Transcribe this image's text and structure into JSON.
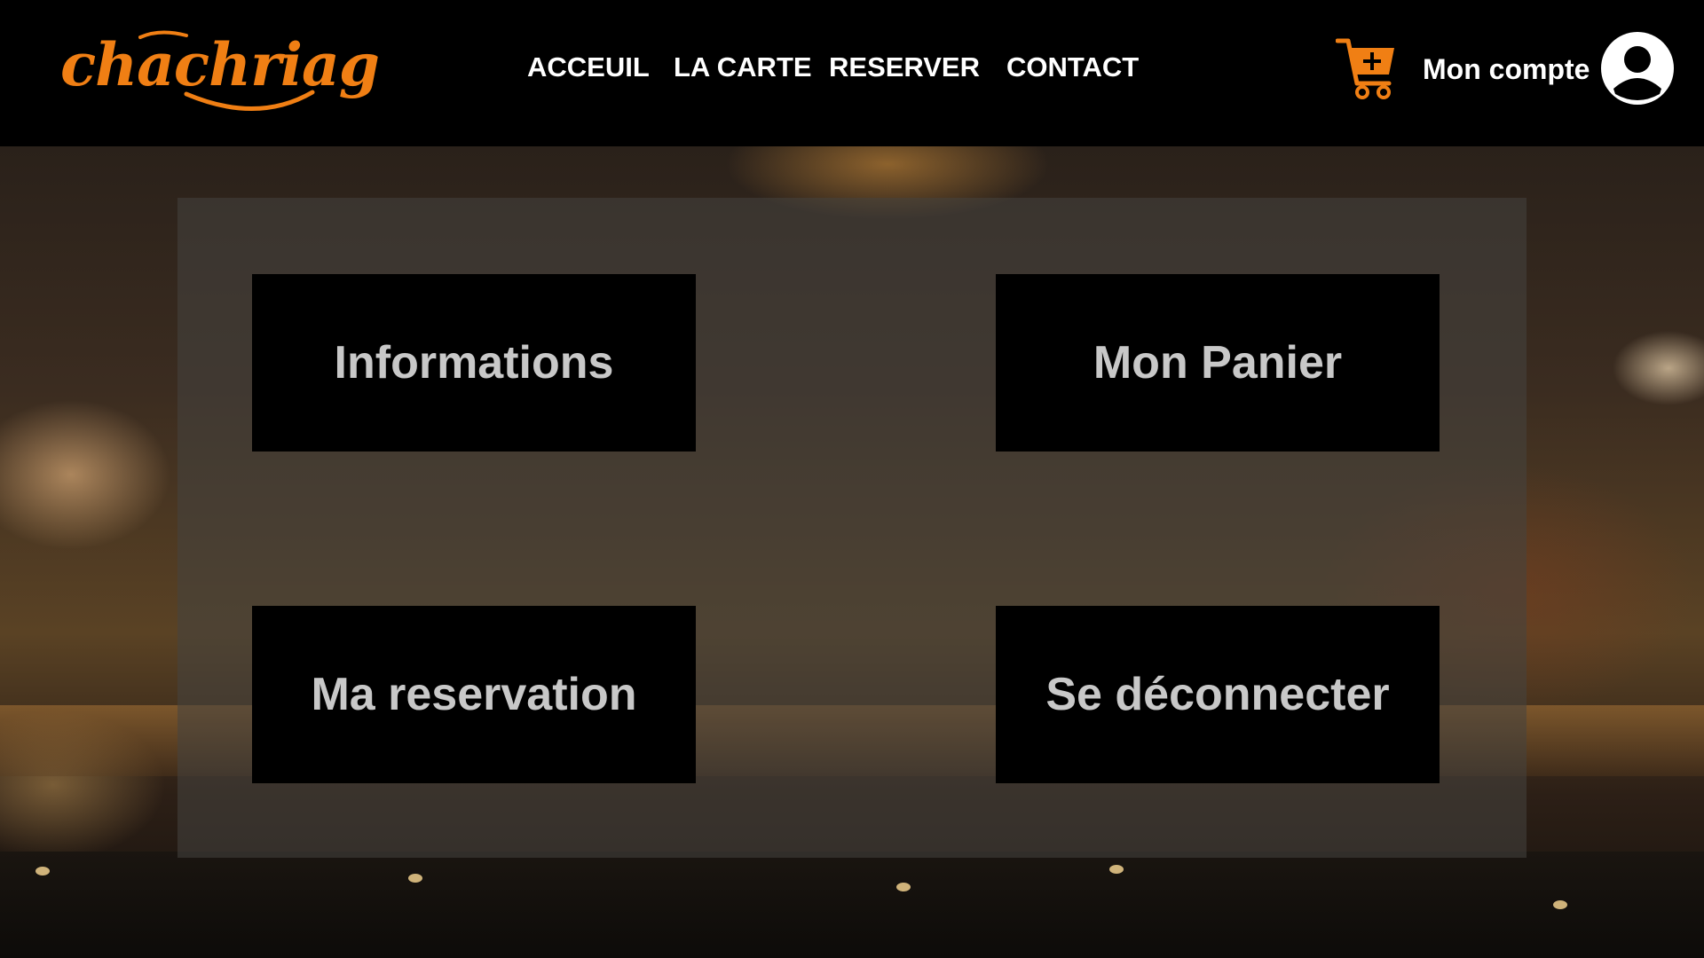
{
  "header": {
    "logo_text": "chachriag",
    "nav": [
      "ACCEUIL",
      "LA CARTE",
      "RESERVER",
      "CONTACT"
    ],
    "account_label": "Mon compte"
  },
  "icons": {
    "cart": "cart-plus-icon",
    "account": "user-circle-icon"
  },
  "colors": {
    "brand": "#f07f14",
    "header_bg": "#000000",
    "tile_bg": "#000000",
    "tile_text": "#c8c8c8"
  },
  "menu": {
    "tiles": [
      "Informations",
      "Mon Panier",
      "Ma reservation",
      "Se déconnecter"
    ]
  }
}
